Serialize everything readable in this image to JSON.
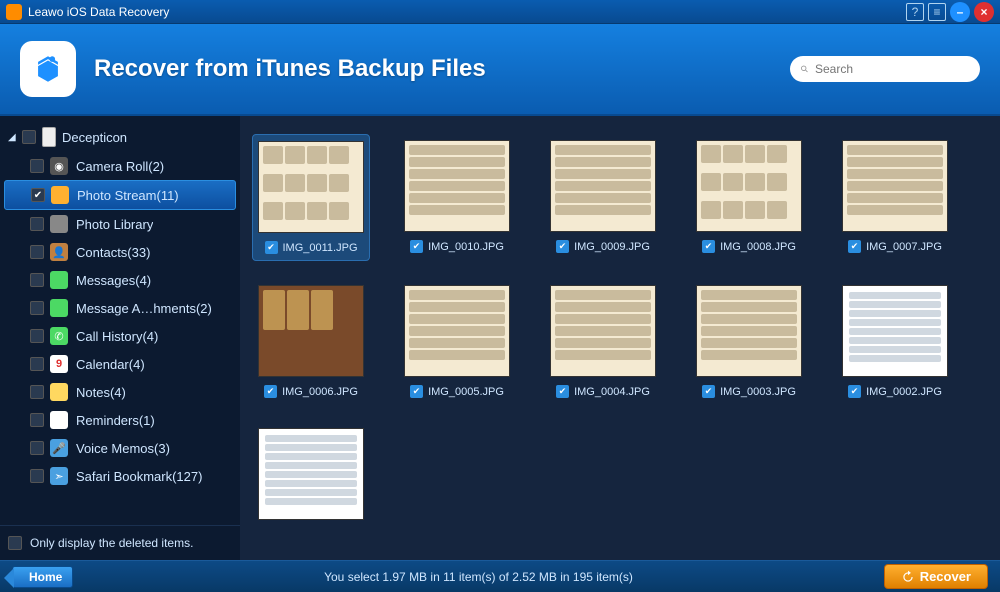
{
  "titlebar": {
    "title": "Leawo iOS Data Recovery"
  },
  "header": {
    "title": "Recover from iTunes Backup Files"
  },
  "search": {
    "placeholder": "Search"
  },
  "sidebar": {
    "device": "Decepticon",
    "items": [
      {
        "label": "Camera Roll(2)",
        "icon": "ic-camera",
        "glyph": "◉",
        "checked": false,
        "selected": false
      },
      {
        "label": "Photo Stream(11)",
        "icon": "ic-stream",
        "glyph": "",
        "checked": true,
        "selected": true
      },
      {
        "label": "Photo Library",
        "icon": "ic-library",
        "glyph": "",
        "checked": false,
        "selected": false
      },
      {
        "label": "Contacts(33)",
        "icon": "ic-contacts",
        "glyph": "👤",
        "checked": false,
        "selected": false
      },
      {
        "label": "Messages(4)",
        "icon": "ic-messages",
        "glyph": "",
        "checked": false,
        "selected": false
      },
      {
        "label": "Message A…hments(2)",
        "icon": "ic-attach",
        "glyph": "",
        "checked": false,
        "selected": false
      },
      {
        "label": "Call History(4)",
        "icon": "ic-call",
        "glyph": "✆",
        "checked": false,
        "selected": false
      },
      {
        "label": "Calendar(4)",
        "icon": "ic-calendar",
        "glyph": "9",
        "checked": false,
        "selected": false
      },
      {
        "label": "Notes(4)",
        "icon": "ic-notes",
        "glyph": "",
        "checked": false,
        "selected": false
      },
      {
        "label": "Reminders(1)",
        "icon": "ic-reminders",
        "glyph": "",
        "checked": false,
        "selected": false
      },
      {
        "label": "Voice Memos(3)",
        "icon": "ic-voice",
        "glyph": "🎤",
        "checked": false,
        "selected": false
      },
      {
        "label": "Safari Bookmark(127)",
        "icon": "ic-safari",
        "glyph": "➣",
        "checked": false,
        "selected": false
      }
    ],
    "only_deleted": "Only display the deleted items."
  },
  "thumbnails": [
    {
      "name": "IMG_0011.JPG",
      "variant": "tv-grid",
      "selected": true
    },
    {
      "name": "IMG_0010.JPG",
      "variant": "tv-rows",
      "selected": false
    },
    {
      "name": "IMG_0009.JPG",
      "variant": "tv-rows",
      "selected": false
    },
    {
      "name": "IMG_0008.JPG",
      "variant": "tv-grid",
      "selected": false
    },
    {
      "name": "IMG_0007.JPG",
      "variant": "tv-rows",
      "selected": false
    },
    {
      "name": "IMG_0006.JPG",
      "variant": "tv-dark",
      "selected": false
    },
    {
      "name": "IMG_0005.JPG",
      "variant": "tv-rows",
      "selected": false
    },
    {
      "name": "IMG_0004.JPG",
      "variant": "tv-rows",
      "selected": false
    },
    {
      "name": "IMG_0003.JPG",
      "variant": "tv-rows",
      "selected": false
    },
    {
      "name": "IMG_0002.JPG",
      "variant": "tv-list",
      "selected": false
    },
    {
      "name": "",
      "variant": "tv-list",
      "selected": false
    }
  ],
  "footer": {
    "home": "Home",
    "status": "You select 1.97 MB in 11 item(s) of 2.52 MB in 195 item(s)",
    "recover": "Recover"
  }
}
